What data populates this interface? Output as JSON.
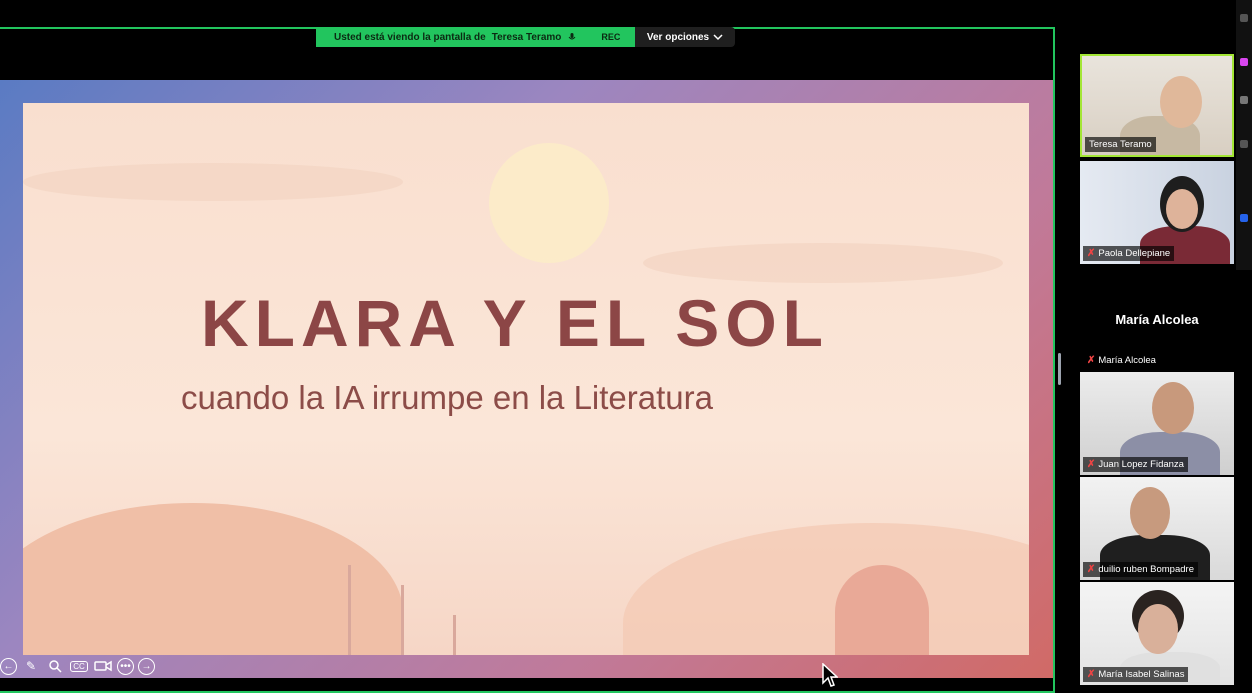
{
  "banner": {
    "sharing_prefix": "Usted está viendo la pantalla de",
    "sharing_name": "Teresa Teramo",
    "rec_label": "REC"
  },
  "options_button": {
    "label": "Ver opciones",
    "icon": "chevron-down-icon"
  },
  "slide": {
    "title": "KLARA Y EL SOL",
    "subtitle": "cuando la IA irrumpe en la Literatura"
  },
  "annotation_toolbar": {
    "icons": [
      "back-arrow-icon",
      "pencil-icon",
      "zoom-icon",
      "captions-icon",
      "camera-icon",
      "more-icon",
      "forward-arrow-icon"
    ],
    "captions_label": "CC"
  },
  "participants": [
    {
      "name": "Teresa Teramo",
      "muted": false,
      "video": true,
      "active": true
    },
    {
      "name": "Paola Dellepiane",
      "muted": true,
      "video": true,
      "active": false
    },
    {
      "name": "María Alcolea",
      "muted": true,
      "video": false,
      "active": false,
      "center_label": "María Alcolea"
    },
    {
      "name": "Juan Lopez Fidanza",
      "muted": true,
      "video": true,
      "active": false
    },
    {
      "name": "duilio ruben Bompadre",
      "muted": true,
      "video": true,
      "active": false
    },
    {
      "name": "María Isabel Salinas",
      "muted": true,
      "video": true,
      "active": false
    }
  ],
  "colors": {
    "sharing_border": "#22c55e",
    "active_speaker": "#a3e635",
    "slide_title": "#8c4646",
    "mute": "#ef4444"
  }
}
